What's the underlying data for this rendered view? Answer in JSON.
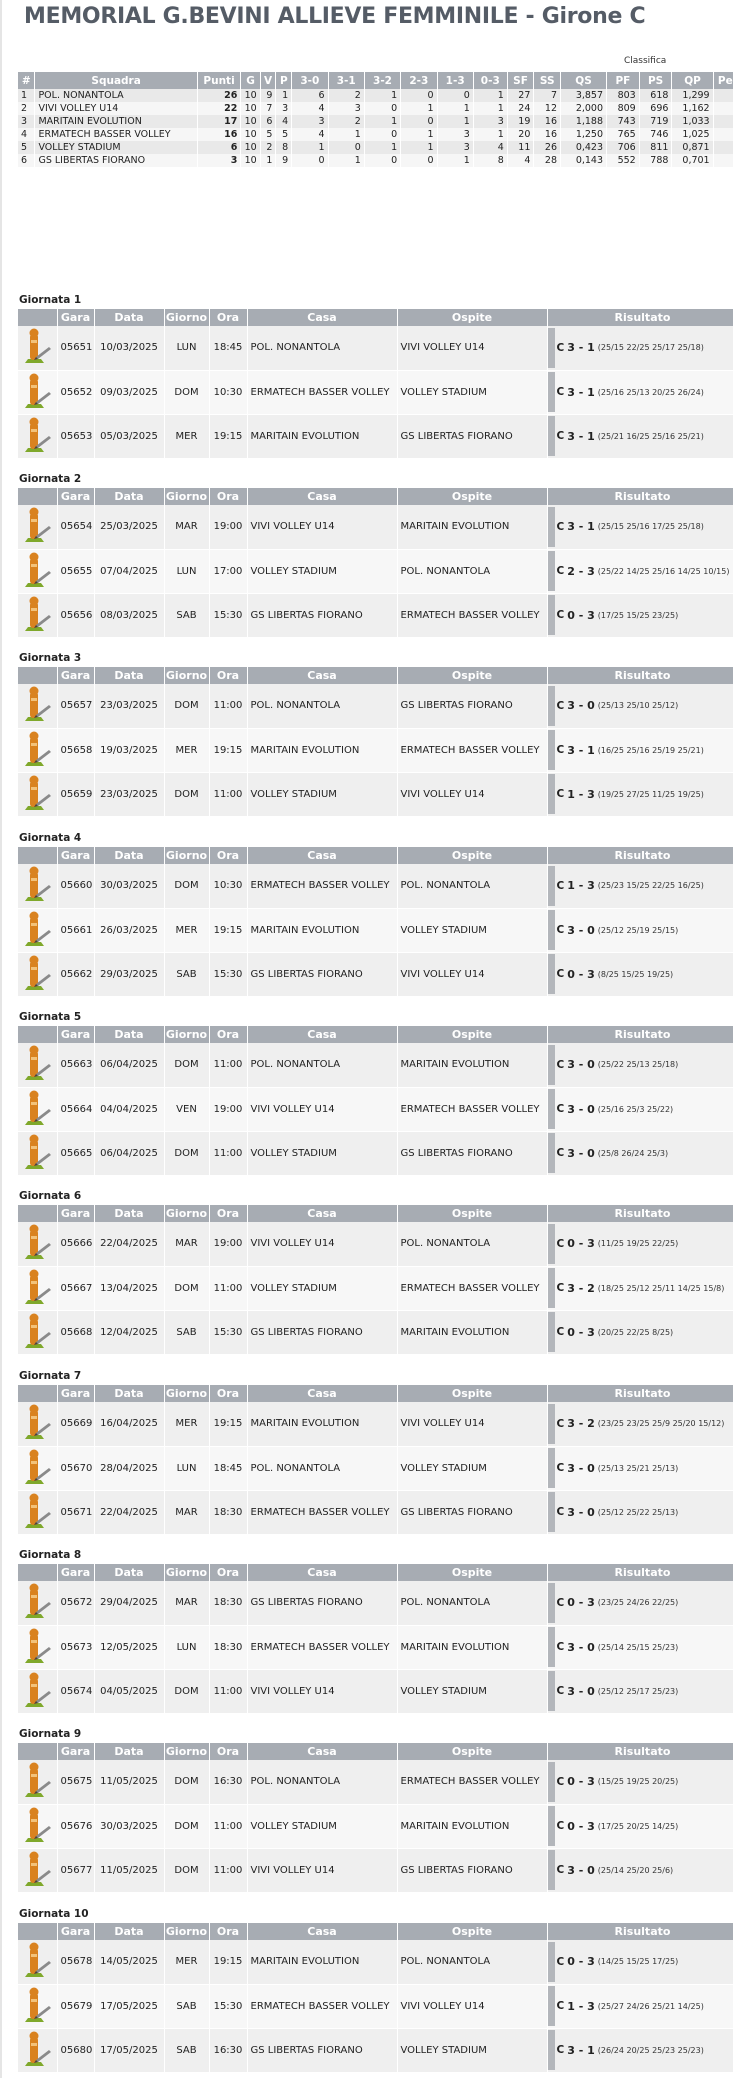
{
  "page_title": "MEMORIAL G.BEVINI ALLIEVE FEMMINILE - Girone C",
  "classifica_caption": "Classifica",
  "standings": {
    "headers": [
      "#",
      "Squadra",
      "Punti",
      "G",
      "V",
      "P",
      "3-0",
      "3-1",
      "3-2",
      "2-3",
      "1-3",
      "0-3",
      "SF",
      "SS",
      "QS",
      "PF",
      "PS",
      "QP",
      "Pe"
    ],
    "rows": [
      [
        "1",
        "POL. NONANTOLA",
        "26",
        "10",
        "9",
        "1",
        "6",
        "2",
        "1",
        "0",
        "0",
        "1",
        "27",
        "7",
        "3,857",
        "803",
        "618",
        "1,299",
        ""
      ],
      [
        "2",
        "VIVI VOLLEY U14",
        "22",
        "10",
        "7",
        "3",
        "4",
        "3",
        "0",
        "1",
        "1",
        "1",
        "24",
        "12",
        "2,000",
        "809",
        "696",
        "1,162",
        ""
      ],
      [
        "3",
        "MARITAIN EVOLUTION",
        "17",
        "10",
        "6",
        "4",
        "3",
        "2",
        "1",
        "0",
        "1",
        "3",
        "19",
        "16",
        "1,188",
        "743",
        "719",
        "1,033",
        ""
      ],
      [
        "4",
        "ERMATECH BASSER VOLLEY",
        "16",
        "10",
        "5",
        "5",
        "4",
        "1",
        "0",
        "1",
        "3",
        "1",
        "20",
        "16",
        "1,250",
        "765",
        "746",
        "1,025",
        ""
      ],
      [
        "5",
        "VOLLEY STADIUM",
        "6",
        "10",
        "2",
        "8",
        "1",
        "0",
        "1",
        "1",
        "3",
        "4",
        "11",
        "26",
        "0,423",
        "706",
        "811",
        "0,871",
        ""
      ],
      [
        "6",
        "GS LIBERTAS FIORANO",
        "3",
        "10",
        "1",
        "9",
        "0",
        "1",
        "0",
        "0",
        "1",
        "8",
        "4",
        "28",
        "0,143",
        "552",
        "788",
        "0,701",
        ""
      ]
    ]
  },
  "match_headers": [
    "",
    "Gara",
    "Data",
    "Giorno",
    "Ora",
    "Casa",
    "Ospite",
    "Risultato"
  ],
  "result_prefix": "C",
  "rounds": [
    {
      "title": "Giornata 1",
      "matches": [
        {
          "gara": "05651",
          "data": "10/03/2025",
          "giorno": "LUN",
          "ora": "18:45",
          "casa": "POL. NONANTOLA",
          "ospite": "VIVI VOLLEY U14",
          "score": "3 - 1",
          "sets": "(25/15 22/25 25/17 25/18)"
        },
        {
          "gara": "05652",
          "data": "09/03/2025",
          "giorno": "DOM",
          "ora": "10:30",
          "casa": "ERMATECH BASSER VOLLEY",
          "ospite": "VOLLEY STADIUM",
          "score": "3 - 1",
          "sets": "(25/16 25/13 20/25 26/24)"
        },
        {
          "gara": "05653",
          "data": "05/03/2025",
          "giorno": "MER",
          "ora": "19:15",
          "casa": "MARITAIN EVOLUTION",
          "ospite": "GS LIBERTAS FIORANO",
          "score": "3 - 1",
          "sets": "(25/21 16/25 25/16 25/21)"
        }
      ]
    },
    {
      "title": "Giornata 2",
      "matches": [
        {
          "gara": "05654",
          "data": "25/03/2025",
          "giorno": "MAR",
          "ora": "19:00",
          "casa": "VIVI VOLLEY U14",
          "ospite": "MARITAIN EVOLUTION",
          "score": "3 - 1",
          "sets": "(25/15 25/16 17/25 25/18)"
        },
        {
          "gara": "05655",
          "data": "07/04/2025",
          "giorno": "LUN",
          "ora": "17:00",
          "casa": "VOLLEY STADIUM",
          "ospite": "POL. NONANTOLA",
          "score": "2 - 3",
          "sets": "(25/22 14/25 25/16 14/25 10/15)"
        },
        {
          "gara": "05656",
          "data": "08/03/2025",
          "giorno": "SAB",
          "ora": "15:30",
          "casa": "GS LIBERTAS FIORANO",
          "ospite": "ERMATECH BASSER VOLLEY",
          "score": "0 - 3",
          "sets": "(17/25 15/25 23/25)"
        }
      ]
    },
    {
      "title": "Giornata 3",
      "matches": [
        {
          "gara": "05657",
          "data": "23/03/2025",
          "giorno": "DOM",
          "ora": "11:00",
          "casa": "POL. NONANTOLA",
          "ospite": "GS LIBERTAS FIORANO",
          "score": "3 - 0",
          "sets": "(25/13 25/10 25/12)"
        },
        {
          "gara": "05658",
          "data": "19/03/2025",
          "giorno": "MER",
          "ora": "19:15",
          "casa": "MARITAIN EVOLUTION",
          "ospite": "ERMATECH BASSER VOLLEY",
          "score": "3 - 1",
          "sets": "(16/25 25/16 25/19 25/21)"
        },
        {
          "gara": "05659",
          "data": "23/03/2025",
          "giorno": "DOM",
          "ora": "11:00",
          "casa": "VOLLEY STADIUM",
          "ospite": "VIVI VOLLEY U14",
          "score": "1 - 3",
          "sets": "(19/25 27/25 11/25 19/25)"
        }
      ]
    },
    {
      "title": "Giornata 4",
      "matches": [
        {
          "gara": "05660",
          "data": "30/03/2025",
          "giorno": "DOM",
          "ora": "10:30",
          "casa": "ERMATECH BASSER VOLLEY",
          "ospite": "POL. NONANTOLA",
          "score": "1 - 3",
          "sets": "(25/23 15/25 22/25 16/25)"
        },
        {
          "gara": "05661",
          "data": "26/03/2025",
          "giorno": "MER",
          "ora": "19:15",
          "casa": "MARITAIN EVOLUTION",
          "ospite": "VOLLEY STADIUM",
          "score": "3 - 0",
          "sets": "(25/12 25/19 25/15)"
        },
        {
          "gara": "05662",
          "data": "29/03/2025",
          "giorno": "SAB",
          "ora": "15:30",
          "casa": "GS LIBERTAS FIORANO",
          "ospite": "VIVI VOLLEY U14",
          "score": "0 - 3",
          "sets": "(8/25 15/25 19/25)"
        }
      ]
    },
    {
      "title": "Giornata 5",
      "matches": [
        {
          "gara": "05663",
          "data": "06/04/2025",
          "giorno": "DOM",
          "ora": "11:00",
          "casa": "POL. NONANTOLA",
          "ospite": "MARITAIN EVOLUTION",
          "score": "3 - 0",
          "sets": "(25/22 25/13 25/18)"
        },
        {
          "gara": "05664",
          "data": "04/04/2025",
          "giorno": "VEN",
          "ora": "19:00",
          "casa": "VIVI VOLLEY U14",
          "ospite": "ERMATECH BASSER VOLLEY",
          "score": "3 - 0",
          "sets": "(25/16 25/3 25/22)"
        },
        {
          "gara": "05665",
          "data": "06/04/2025",
          "giorno": "DOM",
          "ora": "11:00",
          "casa": "VOLLEY STADIUM",
          "ospite": "GS LIBERTAS FIORANO",
          "score": "3 - 0",
          "sets": "(25/8 26/24 25/3)"
        }
      ]
    },
    {
      "title": "Giornata 6",
      "matches": [
        {
          "gara": "05666",
          "data": "22/04/2025",
          "giorno": "MAR",
          "ora": "19:00",
          "casa": "VIVI VOLLEY U14",
          "ospite": "POL. NONANTOLA",
          "score": "0 - 3",
          "sets": "(11/25 19/25 22/25)"
        },
        {
          "gara": "05667",
          "data": "13/04/2025",
          "giorno": "DOM",
          "ora": "11:00",
          "casa": "VOLLEY STADIUM",
          "ospite": "ERMATECH BASSER VOLLEY",
          "score": "3 - 2",
          "sets": "(18/25 25/12 25/11 14/25 15/8)"
        },
        {
          "gara": "05668",
          "data": "12/04/2025",
          "giorno": "SAB",
          "ora": "15:30",
          "casa": "GS LIBERTAS FIORANO",
          "ospite": "MARITAIN EVOLUTION",
          "score": "0 - 3",
          "sets": "(20/25 22/25 8/25)"
        }
      ]
    },
    {
      "title": "Giornata 7",
      "matches": [
        {
          "gara": "05669",
          "data": "16/04/2025",
          "giorno": "MER",
          "ora": "19:15",
          "casa": "MARITAIN EVOLUTION",
          "ospite": "VIVI VOLLEY U14",
          "score": "3 - 2",
          "sets": "(23/25 23/25 25/9 25/20 15/12)"
        },
        {
          "gara": "05670",
          "data": "28/04/2025",
          "giorno": "LUN",
          "ora": "18:45",
          "casa": "POL. NONANTOLA",
          "ospite": "VOLLEY STADIUM",
          "score": "3 - 0",
          "sets": "(25/13 25/21 25/13)"
        },
        {
          "gara": "05671",
          "data": "22/04/2025",
          "giorno": "MAR",
          "ora": "18:30",
          "casa": "ERMATECH BASSER VOLLEY",
          "ospite": "GS LIBERTAS FIORANO",
          "score": "3 - 0",
          "sets": "(25/12 25/22 25/13)"
        }
      ]
    },
    {
      "title": "Giornata 8",
      "matches": [
        {
          "gara": "05672",
          "data": "29/04/2025",
          "giorno": "MAR",
          "ora": "18:30",
          "casa": "GS LIBERTAS FIORANO",
          "ospite": "POL. NONANTOLA",
          "score": "0 - 3",
          "sets": "(23/25 24/26 22/25)"
        },
        {
          "gara": "05673",
          "data": "12/05/2025",
          "giorno": "LUN",
          "ora": "18:30",
          "casa": "ERMATECH BASSER VOLLEY",
          "ospite": "MARITAIN EVOLUTION",
          "score": "3 - 0",
          "sets": "(25/14 25/15 25/23)"
        },
        {
          "gara": "05674",
          "data": "04/05/2025",
          "giorno": "DOM",
          "ora": "11:00",
          "casa": "VIVI VOLLEY U14",
          "ospite": "VOLLEY STADIUM",
          "score": "3 - 0",
          "sets": "(25/12 25/17 25/23)"
        }
      ]
    },
    {
      "title": "Giornata 9",
      "matches": [
        {
          "gara": "05675",
          "data": "11/05/2025",
          "giorno": "DOM",
          "ora": "16:30",
          "casa": "POL. NONANTOLA",
          "ospite": "ERMATECH BASSER VOLLEY",
          "score": "0 - 3",
          "sets": "(15/25 19/25 20/25)"
        },
        {
          "gara": "05676",
          "data": "30/03/2025",
          "giorno": "DOM",
          "ora": "11:00",
          "casa": "VOLLEY STADIUM",
          "ospite": "MARITAIN EVOLUTION",
          "score": "0 - 3",
          "sets": "(17/25 20/25 14/25)"
        },
        {
          "gara": "05677",
          "data": "11/05/2025",
          "giorno": "DOM",
          "ora": "11:00",
          "casa": "VIVI VOLLEY U14",
          "ospite": "GS LIBERTAS FIORANO",
          "score": "3 - 0",
          "sets": "(25/14 25/20 25/6)"
        }
      ]
    },
    {
      "title": "Giornata 10",
      "matches": [
        {
          "gara": "05678",
          "data": "14/05/2025",
          "giorno": "MER",
          "ora": "19:15",
          "casa": "MARITAIN EVOLUTION",
          "ospite": "POL. NONANTOLA",
          "score": "0 - 3",
          "sets": "(14/25 15/25 17/25)"
        },
        {
          "gara": "05679",
          "data": "17/05/2025",
          "giorno": "SAB",
          "ora": "15:30",
          "casa": "ERMATECH BASSER VOLLEY",
          "ospite": "VIVI VOLLEY U14",
          "score": "1 - 3",
          "sets": "(25/27 24/26 25/21 14/25)"
        },
        {
          "gara": "05680",
          "data": "17/05/2025",
          "giorno": "SAB",
          "ora": "16:30",
          "casa": "GS LIBERTAS FIORANO",
          "ospite": "VOLLEY STADIUM",
          "score": "3 - 1",
          "sets": "(26/24 20/25 25/23 25/23)"
        }
      ]
    }
  ],
  "icon": {
    "name": "stats-pencil-icon",
    "colors": {
      "body": "#d9821f",
      "stand": "#7fa82b",
      "pencil": "#8a8a8a"
    }
  }
}
